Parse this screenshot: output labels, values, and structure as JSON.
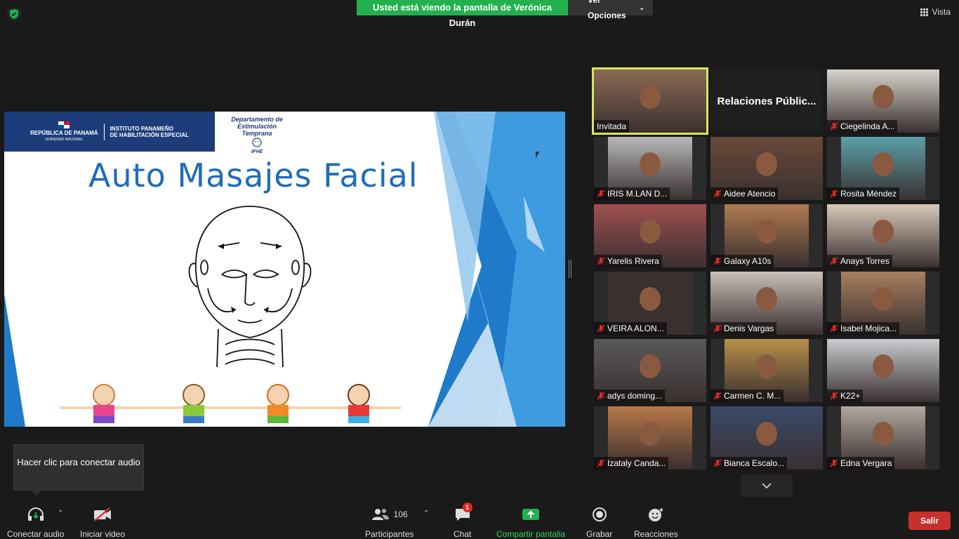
{
  "banner": {
    "sharing_text": "Usted está viendo la pantalla de Verónica Durán",
    "view_options": "Ver Opciones"
  },
  "view_button": "Vista",
  "slide": {
    "header_line1": "REPÚBLICA DE PANAMÁ",
    "header_line2": "GOBIERNO NACIONAL",
    "header_line3": "INSTITUTO PANAMEÑO",
    "header_line4": "DE HABILITACIÓN ESPECIAL",
    "dept_line1": "Departamento de",
    "dept_line2": "Estimulación Temprana",
    "dept_line3": "IPHE",
    "title": "Auto Masajes Facial"
  },
  "participants": [
    {
      "name": "Invitada",
      "muted": false,
      "active": true,
      "bg": "#8a6a55"
    },
    {
      "name": "Relaciones  Públic...",
      "textonly": true
    },
    {
      "name": "Ciegelinda A...",
      "muted": true,
      "bg": "#d8d4cc"
    },
    {
      "name": "IRIS M.LAN D...",
      "muted": true,
      "bg": "#b8b8b8"
    },
    {
      "name": "Aidee Atencio",
      "muted": true,
      "bg": "#6a4a3a"
    },
    {
      "name": "Rosita Méndez",
      "muted": true,
      "bg": "#5aa0a8"
    },
    {
      "name": "Yarelis Rivera",
      "muted": true,
      "bg": "#a05050"
    },
    {
      "name": "Galaxy A10s",
      "muted": true,
      "bg": "#b07a50"
    },
    {
      "name": "Anays Torres",
      "muted": true,
      "bg": "#d8c8b8"
    },
    {
      "name": "VEIRA ALON...",
      "muted": true,
      "bg": "#3a3030"
    },
    {
      "name": "Denis  Vargas",
      "muted": true,
      "bg": "#c8c0b8"
    },
    {
      "name": "Isabel Mojica...",
      "muted": true,
      "bg": "#a88060"
    },
    {
      "name": "adys doming...",
      "muted": true,
      "bg": "#5a5a58"
    },
    {
      "name": "Carmen C. M...",
      "muted": true,
      "bg": "#b89048"
    },
    {
      "name": "K22+",
      "muted": true,
      "bg": "#c8ccd0"
    },
    {
      "name": "Izataly Canda...",
      "muted": true,
      "bg": "#b87848"
    },
    {
      "name": "Bianca Escalo...",
      "muted": true,
      "bg": "#3a4a6a"
    },
    {
      "name": "Edna Vergara",
      "muted": true,
      "bg": "#b0a8a0"
    }
  ],
  "tooltip": "Hacer clic para conectar audio",
  "toolbar": {
    "audio": "Conectar audio",
    "video": "Iniciar video",
    "participants_count": "106",
    "participants": "Participantes",
    "chat": "Chat",
    "chat_badge": "1",
    "share": "Compartir pantalla",
    "record": "Grabar",
    "reactions": "Reacciones",
    "leave": "Salir"
  }
}
